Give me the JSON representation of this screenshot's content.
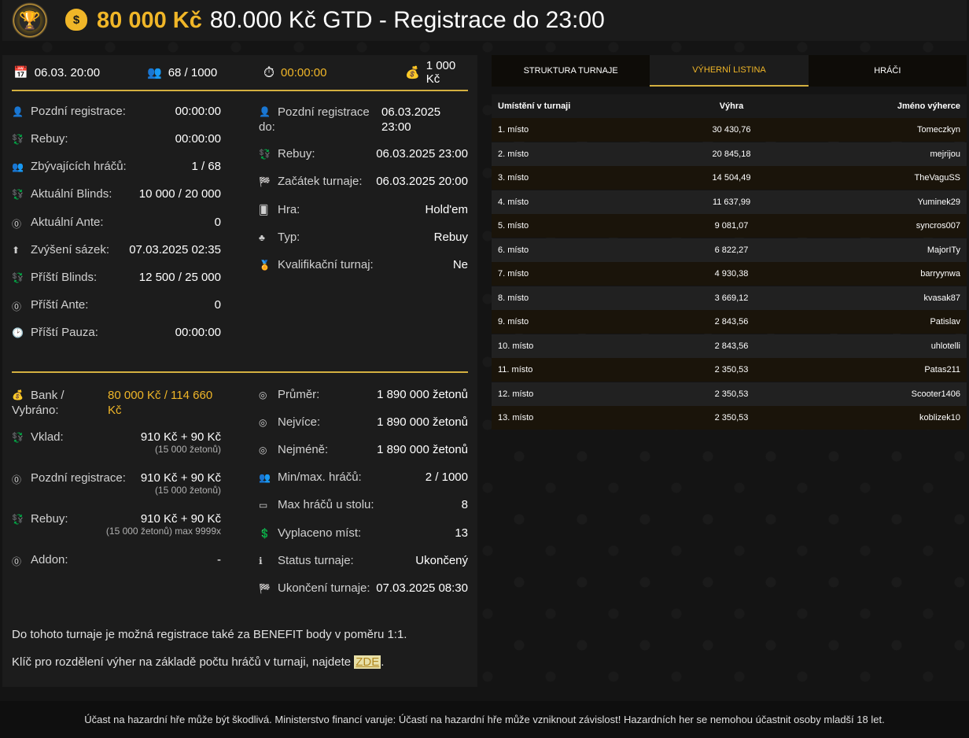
{
  "header": {
    "gtd_amount": "80 000 Kč",
    "title": "80.000 Kč GTD - Registrace do 23:00"
  },
  "topbar": {
    "date": "06.03. 20:00",
    "players": "68 / 1000",
    "timer": "00:00:00",
    "buyin": "1 000 Kč"
  },
  "info_left": [
    {
      "label": "Pozdní registrace:",
      "value": "00:00:00"
    },
    {
      "label": "Rebuy:",
      "value": "00:00:00"
    },
    {
      "label": "Zbývajících hráčů:",
      "value": "1 / 68"
    },
    {
      "label": "Aktuální Blinds:",
      "value": "10 000 / 20 000"
    },
    {
      "label": "Aktuální Ante:",
      "value": "0"
    },
    {
      "label": "Zvýšení sázek:",
      "value": "07.03.2025 02:35"
    },
    {
      "label": "Příští Blinds:",
      "value": "12 500 / 25 000"
    },
    {
      "label": "Příští Ante:",
      "value": "0"
    },
    {
      "label": "Příští Pauza:",
      "value": "00:00:00"
    }
  ],
  "info_right": [
    {
      "label1": "Pozdní registrace",
      "label2": "do:",
      "value1": "06.03.2025",
      "value2": "23:00"
    },
    {
      "label": "Rebuy:",
      "value": "06.03.2025 23:00"
    },
    {
      "label": "Začátek turnaje:",
      "value": "06.03.2025 20:00"
    },
    {
      "label": "Hra:",
      "value": "Hold'em"
    },
    {
      "label": "Typ:",
      "value": "Rebuy"
    },
    {
      "label": "Kvalifikační turnaj:",
      "value": "Ne"
    }
  ],
  "money_left": {
    "bank_label1": "Bank /",
    "bank_label2": "Vybráno:",
    "bank_value1": "80 000 Kč / 114 660",
    "bank_value2": "Kč",
    "vklad_label": "Vklad:",
    "vklad_value": "910 Kč + 90 Kč",
    "vklad_sub": "(15 000 žetonů)",
    "late_label": "Pozdní registrace:",
    "late_value": "910 Kč + 90 Kč",
    "late_sub": "(15 000 žetonů)",
    "rebuy_label": "Rebuy:",
    "rebuy_value": "910 Kč + 90 Kč",
    "rebuy_sub": "(15 000 žetonů) max 9999x",
    "addon_label": "Addon:",
    "addon_value": "-"
  },
  "money_right": [
    {
      "label": "Průměr:",
      "value": "1 890 000 žetonů"
    },
    {
      "label": "Nejvíce:",
      "value": "1 890 000 žetonů"
    },
    {
      "label": "Nejméně:",
      "value": "1 890 000 žetonů"
    },
    {
      "label": "Min/max. hráčů:",
      "value": "2 / 1000"
    },
    {
      "label": "Max hráčů u stolu:",
      "value": "8"
    },
    {
      "label": "Vyplaceno míst:",
      "value": "13"
    },
    {
      "label": "Status turnaje:",
      "value": "Ukončený"
    },
    {
      "label": "Ukončení turnaje:",
      "value": "07.03.2025 08:30"
    }
  ],
  "notes": {
    "benefit": "Do tohoto turnaje je možná registrace také za BENEFIT body v poměru 1:1.",
    "key_text": "Klíč pro rozdělení výher na základě počtu hráčů v turnaji, najdete",
    "key_link": "ZDE",
    "key_end": "."
  },
  "tabs": [
    "STRUKTURA TURNAJE",
    "VÝHERNÍ LISTINA",
    "HRÁČI"
  ],
  "table": {
    "headers": [
      "Umístění v turnaji",
      "Výhra",
      "Jméno výherce"
    ],
    "rows": [
      [
        "1. místo",
        "30 430,76",
        "Tomeczkyn"
      ],
      [
        "2. místo",
        "20 845,18",
        "mejrijou"
      ],
      [
        "3. místo",
        "14 504,49",
        "TheVaguSS"
      ],
      [
        "4. místo",
        "11 637,99",
        "Yuminek29"
      ],
      [
        "5. místo",
        "9 081,07",
        "syncros007"
      ],
      [
        "6. místo",
        "6 822,27",
        "MajorITy"
      ],
      [
        "7. místo",
        "4 930,38",
        "barryynwa"
      ],
      [
        "8. místo",
        "3 669,12",
        "kvasak87"
      ],
      [
        "9. místo",
        "2 843,56",
        "Patislav"
      ],
      [
        "10. místo",
        "2 843,56",
        "uhlotelli"
      ],
      [
        "11. místo",
        "2 350,53",
        "Patas211"
      ],
      [
        "12. místo",
        "2 350,53",
        "Scooter1406"
      ],
      [
        "13. místo",
        "2 350,53",
        "koblizek10"
      ]
    ]
  },
  "footer": "Účast na hazardní hře může být škodlivá. Ministerstvo financí varuje: Účastí na hazardní hře může vzniknout závislost! Hazardních her se nemohou účastnit osoby mladší 18 let."
}
